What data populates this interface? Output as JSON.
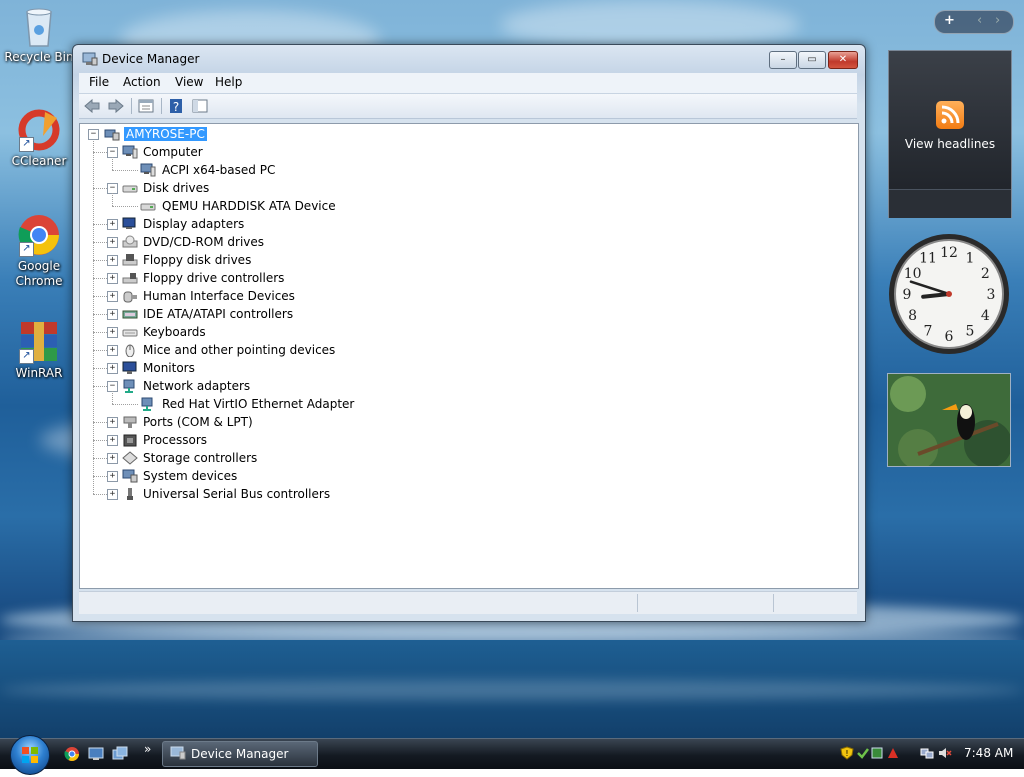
{
  "desktop": {
    "icons": [
      {
        "label": "Recycle Bin"
      },
      {
        "label": "CCleaner"
      },
      {
        "label": "Google Chrome"
      },
      {
        "label": "WinRAR"
      }
    ]
  },
  "window": {
    "title": "Device Manager",
    "caption_buttons": {
      "minimize": "–",
      "maximize": "▭",
      "close": "✕"
    },
    "menu": [
      "File",
      "Action",
      "View",
      "Help"
    ],
    "toolbar": {
      "back_icon": "back-arrow-icon",
      "forward_icon": "forward-arrow-icon",
      "properties_icon": "properties-icon",
      "help_icon": "help-icon",
      "view_icon": "view-pane-icon"
    },
    "tree": {
      "root": "AMYROSE-PC",
      "categories": [
        {
          "label": "Computer",
          "expanded": true,
          "children": [
            "ACPI x64-based PC"
          ],
          "icon": "computer-icon"
        },
        {
          "label": "Disk drives",
          "expanded": true,
          "children": [
            "QEMU HARDDISK ATA Device"
          ],
          "icon": "disk-drive-icon"
        },
        {
          "label": "Display adapters",
          "expanded": false,
          "icon": "display-adapter-icon"
        },
        {
          "label": "DVD/CD-ROM drives",
          "expanded": false,
          "icon": "dvd-drive-icon"
        },
        {
          "label": "Floppy disk drives",
          "expanded": false,
          "icon": "floppy-drive-icon"
        },
        {
          "label": "Floppy drive controllers",
          "expanded": false,
          "icon": "floppy-controller-icon"
        },
        {
          "label": "Human Interface Devices",
          "expanded": false,
          "icon": "hid-icon"
        },
        {
          "label": "IDE ATA/ATAPI controllers",
          "expanded": false,
          "icon": "ide-controller-icon"
        },
        {
          "label": "Keyboards",
          "expanded": false,
          "icon": "keyboard-icon"
        },
        {
          "label": "Mice and other pointing devices",
          "expanded": false,
          "icon": "mouse-icon"
        },
        {
          "label": "Monitors",
          "expanded": false,
          "icon": "monitor-icon"
        },
        {
          "label": "Network adapters",
          "expanded": true,
          "children": [
            "Red Hat VirtIO Ethernet Adapter"
          ],
          "icon": "network-adapter-icon"
        },
        {
          "label": "Ports (COM & LPT)",
          "expanded": false,
          "icon": "port-icon"
        },
        {
          "label": "Processors",
          "expanded": false,
          "icon": "processor-icon"
        },
        {
          "label": "Storage controllers",
          "expanded": false,
          "icon": "storage-controller-icon"
        },
        {
          "label": "System devices",
          "expanded": false,
          "icon": "system-device-icon"
        },
        {
          "label": "Universal Serial Bus controllers",
          "expanded": false,
          "icon": "usb-icon"
        }
      ]
    }
  },
  "gadgets": {
    "sidebar_controls": {
      "add": "+",
      "prev": "‹",
      "next": "›"
    },
    "feed": {
      "label": "View headlines"
    },
    "clock": {
      "hour": 8,
      "minute": 48,
      "numbers": [
        "12",
        "1",
        "2",
        "3",
        "4",
        "5",
        "6",
        "7",
        "8",
        "9",
        "10",
        "11"
      ]
    }
  },
  "taskbar": {
    "task": "Device Manager",
    "time": "7:48 AM",
    "quick_launch_more": "»"
  },
  "colors": {
    "selection": "#3399ff",
    "feed_orange": "#f27c13",
    "close_red": "#c0392b"
  }
}
